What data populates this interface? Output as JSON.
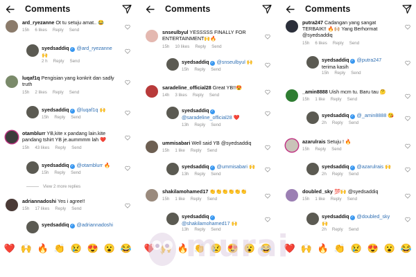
{
  "header": {
    "title": "Comments"
  },
  "actions": {
    "reply": "Reply",
    "send": "Send"
  },
  "panels": [
    {
      "comments": [
        {
          "user": "ard_ryezanne",
          "text": "Ot tu setuju amat.. 😂",
          "time": "15h",
          "likes": "6 likes",
          "avatar": "#8b7b6b"
        },
        {
          "user": "syedsaddiq",
          "verified": true,
          "reply": true,
          "mention": "@ard_ryezanne",
          "text": "🙌",
          "time": "2 h",
          "likes": "",
          "avatar": "#5b5a52"
        },
        {
          "user": "luqaf1q",
          "text": "Pengisian yang konkrit dan sadly truth",
          "time": "15h",
          "likes": "2 likes",
          "avatar": "#7a8a6a"
        },
        {
          "user": "syedsaddiq",
          "verified": true,
          "reply": true,
          "mention": "@luqaf1q",
          "text": "🙌",
          "time": "15h",
          "likes": "",
          "avatar": "#5b5a52"
        },
        {
          "user": "otamblurr",
          "text": "YB,kite x pandang lain.kite pandang tshirt YB je.aummmm lah ❤️",
          "time": "15h",
          "likes": "43 likes",
          "avatar": "#3c3c3c"
        },
        {
          "user": "syedsaddiq",
          "verified": true,
          "reply": true,
          "mention": "@otamblurr",
          "text": "🔥",
          "time": "15h",
          "likes": "",
          "avatar": "#5b5a52"
        },
        {
          "user": "adriannadoshi",
          "text": "Yes i agree!!",
          "time": "15h",
          "likes": "17 likes",
          "avatar": "#4a3a36"
        },
        {
          "user": "syedsaddiq",
          "verified": true,
          "reply": true,
          "mention": "@adriannadoshi",
          "text": "",
          "time": "",
          "likes": "",
          "avatar": "#5b5a52"
        }
      ],
      "view_more": "View 2 more replies"
    },
    {
      "comments": [
        {
          "user": "snseulbyul",
          "text": "YESSSSS FINALLY FOR ENTERTAINMENT🙌🔥",
          "time": "15h",
          "likes": "10 likes",
          "avatar": "#e4b8b0"
        },
        {
          "user": "syedsaddiq",
          "verified": true,
          "reply": true,
          "mention": "@snseulbyul",
          "text": "🙌",
          "time": "15h",
          "likes": "",
          "avatar": "#5b5a52"
        },
        {
          "user": "saradeline_official28",
          "text": "Great YB!!😍",
          "time": "14h",
          "likes": "3 likes",
          "avatar": "#b83a3a"
        },
        {
          "user": "syedsaddiq",
          "verified": true,
          "reply": true,
          "mention": "@saradeline_official28",
          "text": "❤️",
          "time": "13h",
          "likes": "",
          "avatar": "#5b5a52"
        },
        {
          "user": "ummisabari",
          "text": "Well said YB @syedsaddiq",
          "time": "15h",
          "likes": "1 like",
          "avatar": "#6d5f52"
        },
        {
          "user": "syedsaddiq",
          "verified": true,
          "reply": true,
          "mention": "@ummisabari",
          "text": "🙌",
          "time": "13h",
          "likes": "",
          "avatar": "#5b5a52"
        },
        {
          "user": "shakilamohamed17",
          "text": "👏👏👏👏👏👏",
          "time": "15h",
          "likes": "1 like",
          "avatar": "#9a8a7d"
        },
        {
          "user": "syedsaddiq",
          "verified": true,
          "reply": true,
          "mention": "@shakilamohamed17",
          "text": "🙌",
          "time": "13h",
          "likes": "",
          "avatar": "#5b5a52"
        }
      ]
    },
    {
      "comments": [
        {
          "user": "putra247",
          "text": "Cadangan yang sangat TERBAIK!! 🔥🙌🏼 Yang Berhormat @syedsaddiq",
          "time": "15h",
          "likes": "6 likes",
          "avatar": "#2b2f3a"
        },
        {
          "user": "syedsaddiq",
          "verified": true,
          "reply": true,
          "mention": "@putra247",
          "text": "terima kasih",
          "time": "15h",
          "likes": "",
          "avatar": "#5b5a52"
        },
        {
          "user": "_amin8888",
          "text": "Uish mcm tu. Baru tau 🤔",
          "time": "15h",
          "likes": "1 like",
          "avatar": "#2e7d32"
        },
        {
          "user": "syedsaddiq",
          "verified": true,
          "reply": true,
          "mention": "@_amin8888",
          "text": "😘",
          "time": "2h",
          "likes": "",
          "avatar": "#5b5a52"
        },
        {
          "user": "azarulrais",
          "text": "Setuju ! 🔥",
          "time": "15h",
          "likes": "",
          "avatar": "#c9c3b8"
        },
        {
          "user": "syedsaddiq",
          "verified": true,
          "reply": true,
          "mention": "@azarulrais",
          "text": "🙌",
          "time": "2h",
          "likes": "",
          "avatar": "#5b5a52"
        },
        {
          "user": "doubled_sky",
          "text": "💯🙌 @syedsaddiq",
          "time": "15h",
          "likes": "1 like",
          "avatar": "#9b7fb3"
        },
        {
          "user": "syedsaddiq",
          "verified": true,
          "reply": true,
          "mention": "@doubled_sky",
          "text": "🙌",
          "time": "2h",
          "likes": "",
          "avatar": "#5b5a52"
        }
      ]
    }
  ],
  "emoji_bar": [
    "❤️",
    "🙌",
    "🔥",
    "👏",
    "😢",
    "😍",
    "😮",
    "😂"
  ],
  "watermark": {
    "text": "murai"
  },
  "colors": {
    "mention": "#2f6fb3",
    "meta": "#8e8e8e",
    "verified": "#3897f0",
    "watermark": "#decde1"
  }
}
